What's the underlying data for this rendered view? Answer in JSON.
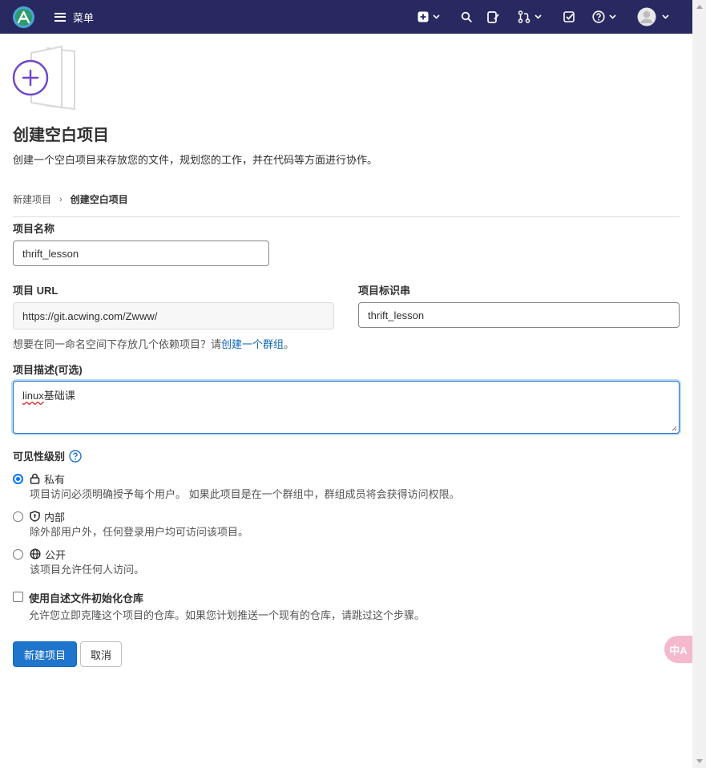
{
  "nav": {
    "menu_label": "菜单",
    "icons": [
      "plus-square-icon",
      "search-icon",
      "issues-icon",
      "merge-request-icon",
      "todo-icon",
      "help-icon",
      "avatar"
    ]
  },
  "header": {
    "title": "创建空白项目",
    "subtitle": "创建一个空白项目来存放您的文件，规划您的工作，并在代码等方面进行协作。"
  },
  "breadcrumb": {
    "parent": "新建项目",
    "current": "创建空白项目"
  },
  "form": {
    "project_name_label": "项目名称",
    "project_name_value": "thrift_lesson",
    "project_url_label": "项目 URL",
    "project_url_value": "https://git.acwing.com/Zwww/",
    "project_slug_label": "项目标识串",
    "project_slug_value": "thrift_lesson",
    "namespace_help_prefix": "想要在同一命名空间下存放几个依赖项目？请",
    "namespace_help_link": "创建一个群组",
    "namespace_help_suffix": "。",
    "description_label": "项目描述(可选)",
    "description_value_misspelled": "linux",
    "description_value_rest": "基础课"
  },
  "visibility": {
    "label": "可见性级别",
    "options": [
      {
        "title": "私有",
        "desc": "项目访问必须明确授予每个用户。 如果此项目是在一个群组中，群组成员将会获得访问权限。",
        "checked": true
      },
      {
        "title": "内部",
        "desc": "除外部用户外，任何登录用户均可访问该项目。",
        "checked": false
      },
      {
        "title": "公开",
        "desc": "该项目允许任何人访问。",
        "checked": false
      }
    ]
  },
  "readme": {
    "title": "使用自述文件初始化仓库",
    "desc": "允许您立即克隆这个项目的仓库。如果您计划推送一个现有的仓库，请跳过这个步骤。",
    "checked": false
  },
  "actions": {
    "create_label": "新建项目",
    "cancel_label": "取消"
  },
  "fab": {
    "label": "中A"
  },
  "colors": {
    "nav_bg": "#292961",
    "primary": "#1f75cb",
    "link": "#1068bf",
    "illustration_purple": "#6e49cb"
  }
}
